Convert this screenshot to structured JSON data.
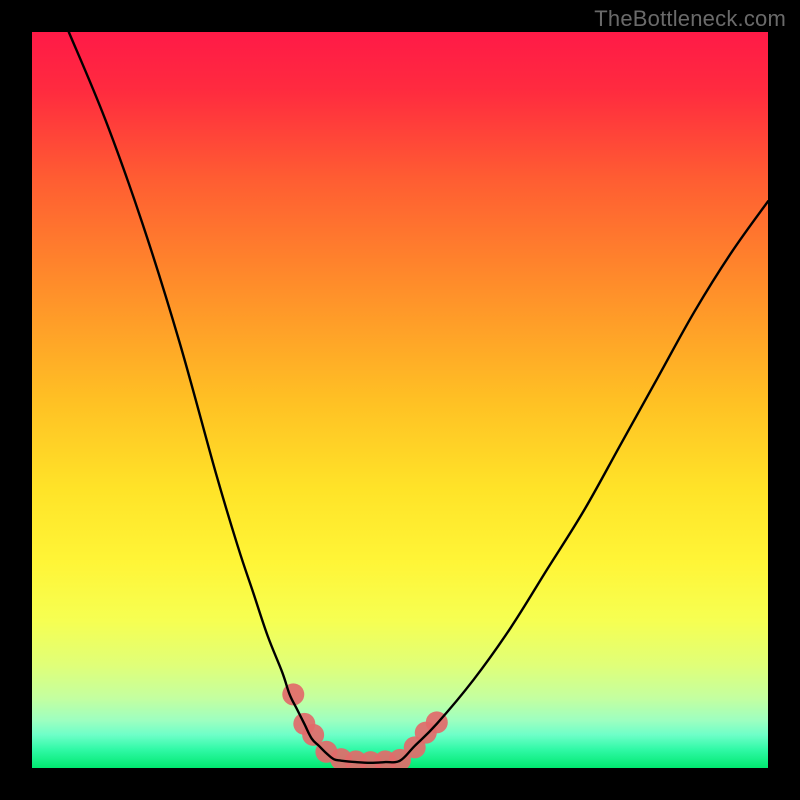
{
  "watermark": "TheBottleneck.com",
  "chart_data": {
    "type": "line",
    "title": "",
    "xlabel": "",
    "ylabel": "",
    "xlim": [
      0,
      100
    ],
    "ylim": [
      0,
      100
    ],
    "note": "Bottleneck-style V-curve over a vertical heat gradient. No axis ticks or numeric labels are visible; values below are pixel-normalised (0–100).",
    "series": [
      {
        "name": "left-curve",
        "x": [
          5,
          10,
          15,
          20,
          25,
          28,
          30,
          32,
          34,
          35,
          36,
          37,
          38,
          39,
          40,
          41,
          42
        ],
        "y": [
          100,
          88,
          74,
          58,
          40,
          30,
          24,
          18,
          13,
          10,
          8,
          6,
          4,
          3,
          2,
          1.2,
          1
        ]
      },
      {
        "name": "trough",
        "x": [
          42,
          44,
          46,
          48,
          50
        ],
        "y": [
          1,
          0.8,
          0.7,
          0.8,
          1
        ]
      },
      {
        "name": "right-curve",
        "x": [
          50,
          52,
          55,
          60,
          65,
          70,
          75,
          80,
          85,
          90,
          95,
          100
        ],
        "y": [
          1,
          3,
          6,
          12,
          19,
          27,
          35,
          44,
          53,
          62,
          70,
          77
        ]
      }
    ],
    "markers": {
      "name": "trough-highlight",
      "color": "#e26a6a",
      "points_x": [
        35.5,
        37,
        38.2,
        40,
        42,
        44,
        46,
        48,
        50,
        52,
        53.5,
        55
      ],
      "points_y": [
        10,
        6,
        4.5,
        2.2,
        1.2,
        0.9,
        0.8,
        0.9,
        1.1,
        2.8,
        4.8,
        6.2
      ]
    },
    "gradient_stops": [
      {
        "offset": 0.0,
        "color": "#ff1a47"
      },
      {
        "offset": 0.08,
        "color": "#ff2b3f"
      },
      {
        "offset": 0.2,
        "color": "#ff5d32"
      },
      {
        "offset": 0.35,
        "color": "#ff8f2a"
      },
      {
        "offset": 0.5,
        "color": "#ffc024"
      },
      {
        "offset": 0.62,
        "color": "#ffe328"
      },
      {
        "offset": 0.72,
        "color": "#fff537"
      },
      {
        "offset": 0.8,
        "color": "#f6ff52"
      },
      {
        "offset": 0.86,
        "color": "#e0ff78"
      },
      {
        "offset": 0.905,
        "color": "#c4ffa0"
      },
      {
        "offset": 0.935,
        "color": "#9effc0"
      },
      {
        "offset": 0.955,
        "color": "#6effc8"
      },
      {
        "offset": 0.975,
        "color": "#30f9a6"
      },
      {
        "offset": 1.0,
        "color": "#00e86f"
      }
    ]
  }
}
